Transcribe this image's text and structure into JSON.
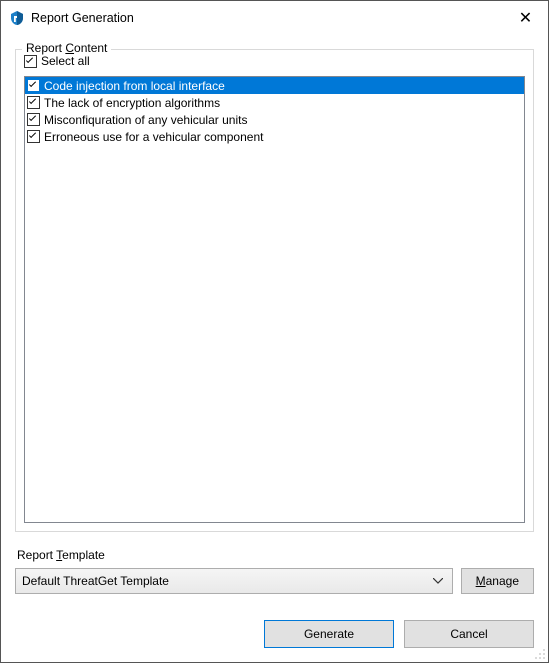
{
  "window": {
    "title": "Report Generation",
    "close_glyph": "✕"
  },
  "group": {
    "label_pre": "Report ",
    "label_accel": "C",
    "label_post": "ontent",
    "select_all_label": "Select all",
    "select_all_checked": true
  },
  "items": [
    {
      "label": "Code injection from local interface",
      "checked": true,
      "selected": true
    },
    {
      "label": "The lack of encryption algorithms",
      "checked": true,
      "selected": false
    },
    {
      "label": "Misconfiquration of any vehicular units",
      "checked": true,
      "selected": false
    },
    {
      "label": "Erroneous use for a vehicular component",
      "checked": true,
      "selected": false
    }
  ],
  "template_section": {
    "label_pre": "Report ",
    "label_accel": "T",
    "label_post": "emplate",
    "selected": "Default ThreatGet Template",
    "manage_pre": "",
    "manage_accel": "M",
    "manage_post": "anage"
  },
  "buttons": {
    "generate": "Generate",
    "cancel": "Cancel"
  }
}
